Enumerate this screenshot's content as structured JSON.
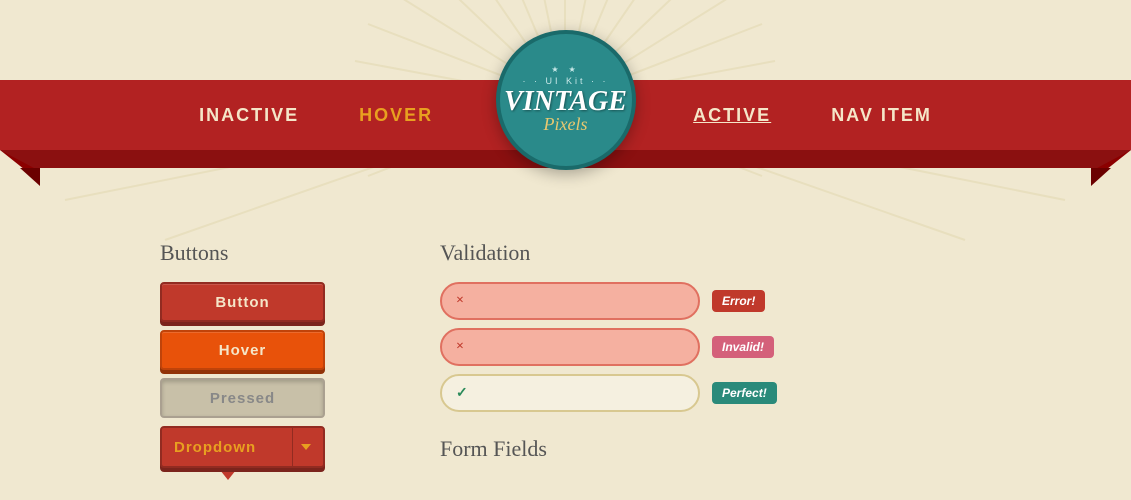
{
  "logo": {
    "ui_kit_label": "· · UI Kit · ·",
    "dots": "★ ★",
    "vintage_text": "VINTAGE",
    "pixels_text": "Pixels"
  },
  "nav": {
    "items": [
      {
        "id": "inactive",
        "label": "INACTIVE",
        "state": "default"
      },
      {
        "id": "hover",
        "label": "HOVER",
        "state": "hover"
      },
      {
        "id": "active",
        "label": "ACTIVE",
        "state": "active"
      },
      {
        "id": "nav-item",
        "label": "NAV ITEM",
        "state": "default"
      }
    ]
  },
  "buttons": {
    "section_title": "Buttons",
    "items": [
      {
        "id": "default",
        "label": "Button",
        "state": "default"
      },
      {
        "id": "hover",
        "label": "Hover",
        "state": "hover"
      },
      {
        "id": "pressed",
        "label": "Pressed",
        "state": "pressed"
      }
    ],
    "dropdown_label": "Dropdown"
  },
  "validation": {
    "section_title": "Validation",
    "rows": [
      {
        "id": "error",
        "icon": "×",
        "state": "error",
        "badge": "Error!"
      },
      {
        "id": "invalid",
        "icon": "×",
        "state": "invalid",
        "badge": "Invalid!"
      },
      {
        "id": "success",
        "icon": "✓",
        "state": "success",
        "badge": "Perfect!"
      }
    ]
  },
  "form_fields": {
    "section_title": "Form Fields"
  },
  "colors": {
    "brand_red": "#c0392b",
    "brand_teal": "#2a8a8a",
    "brand_orange": "#e8a020",
    "bg_cream": "#f0e8d0",
    "nav_bg": "#b22222"
  }
}
